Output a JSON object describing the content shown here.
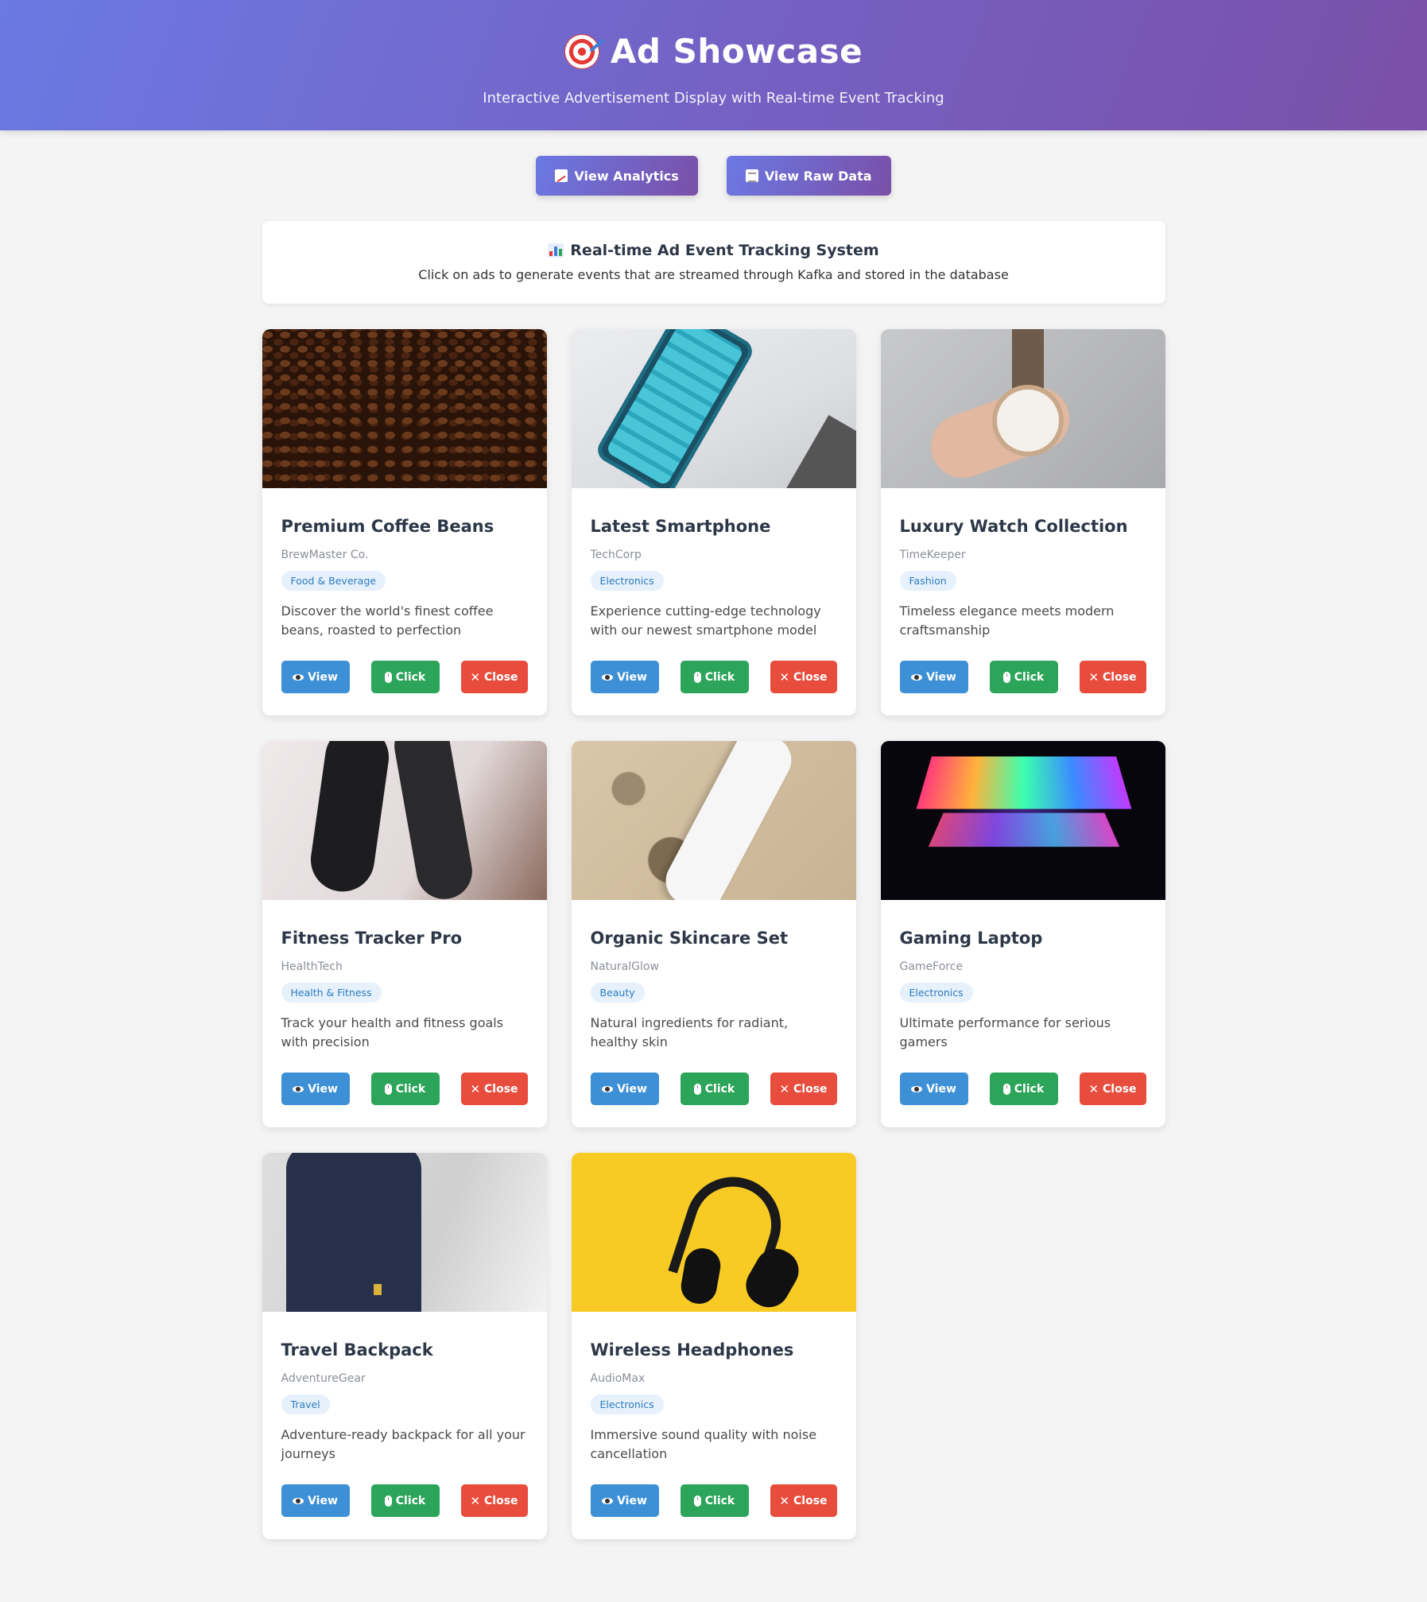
{
  "header": {
    "title": "Ad Showcase",
    "subtitle": "Interactive Advertisement Display with Real-time Event Tracking",
    "icon": "target-icon"
  },
  "actions": {
    "analytics_label": "View Analytics",
    "raw_data_label": "View Raw Data"
  },
  "info": {
    "title": "Real-time Ad Event Tracking System",
    "text": "Click on ads to generate events that are streamed through Kafka and stored in the database"
  },
  "button_labels": {
    "view": "View",
    "click": "Click",
    "close": "Close"
  },
  "ads": [
    {
      "title": "Premium Coffee Beans",
      "company": "BrewMaster Co.",
      "category": "Food & Beverage",
      "description": "Discover the world's finest coffee beans, roasted to perfection"
    },
    {
      "title": "Latest Smartphone",
      "company": "TechCorp",
      "category": "Electronics",
      "description": "Experience cutting-edge technology with our newest smartphone model"
    },
    {
      "title": "Luxury Watch Collection",
      "company": "TimeKeeper",
      "category": "Fashion",
      "description": "Timeless elegance meets modern craftsmanship"
    },
    {
      "title": "Fitness Tracker Pro",
      "company": "HealthTech",
      "category": "Health & Fitness",
      "description": "Track your health and fitness goals with precision"
    },
    {
      "title": "Organic Skincare Set",
      "company": "NaturalGlow",
      "category": "Beauty",
      "description": "Natural ingredients for radiant, healthy skin"
    },
    {
      "title": "Gaming Laptop",
      "company": "GameForce",
      "category": "Electronics",
      "description": "Ultimate performance for serious gamers"
    },
    {
      "title": "Travel Backpack",
      "company": "AdventureGear",
      "category": "Travel",
      "description": "Adventure-ready backpack for all your journeys"
    },
    {
      "title": "Wireless Headphones",
      "company": "AudioMax",
      "category": "Electronics",
      "description": "Immersive sound quality with noise cancellation"
    }
  ],
  "colors": {
    "header_gradient_start": "#6b79e3",
    "header_gradient_end": "#7a4fa8",
    "view_button": "#3d90d6",
    "click_button": "#2ca55a",
    "close_button": "#e74c3c",
    "tag_bg": "#e6f1fb",
    "tag_text": "#2b7bc0"
  }
}
